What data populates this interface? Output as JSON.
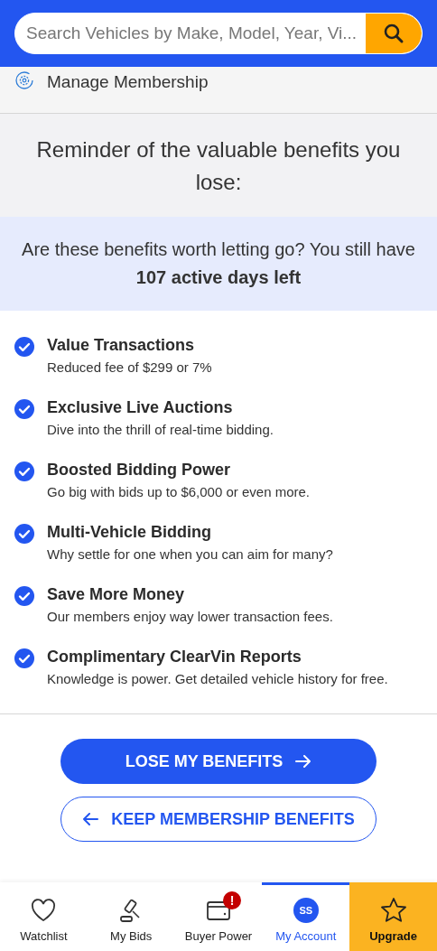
{
  "search": {
    "placeholder": "Search Vehicles by Make, Model, Year, Vi..."
  },
  "manage": {
    "label": "Manage Membership"
  },
  "reminder": {
    "title": "Reminder of the valuable benefits you lose:"
  },
  "notice": {
    "text": "Are these benefits worth letting go? You still have **107 active days left**"
  },
  "benefits": [
    {
      "title": "Value Transactions",
      "description": "Reduced fee of $299 or 7%"
    },
    {
      "title": "Exclusive Live Auctions",
      "description": "Dive into the thrill of real-time bidding."
    },
    {
      "title": "Boosted Bidding Power",
      "description": "Go big with bids up to $6,000 or even more."
    },
    {
      "title": "Multi-Vehicle Bidding",
      "description": "Why settle for one when you can aim for many?"
    },
    {
      "title": "Save More Money",
      "description": "Our members enjoy way lower transaction fees."
    },
    {
      "title": "Complimentary ClearVin Reports",
      "description": "Knowledge is power. Get detailed vehicle history for free."
    }
  ],
  "buttons": [
    {
      "kind": "primary",
      "label": "LOSE MY BENEFITS"
    },
    {
      "kind": "secondary",
      "label": "KEEP MEMBERSHIP BENEFITS"
    }
  ],
  "nav": [
    {
      "kind": "heart",
      "label": "Watchlist",
      "selected": false
    },
    {
      "kind": "gavel",
      "label": "My Bids",
      "selected": false
    },
    {
      "kind": "wallet",
      "label": "Buyer Power",
      "badge": "!",
      "selected": false
    },
    {
      "kind": "avatar",
      "label": "My Account",
      "avatar": "SS",
      "selected": true
    },
    {
      "kind": "upgrade",
      "label": "Upgrade",
      "selected": false
    }
  ]
}
